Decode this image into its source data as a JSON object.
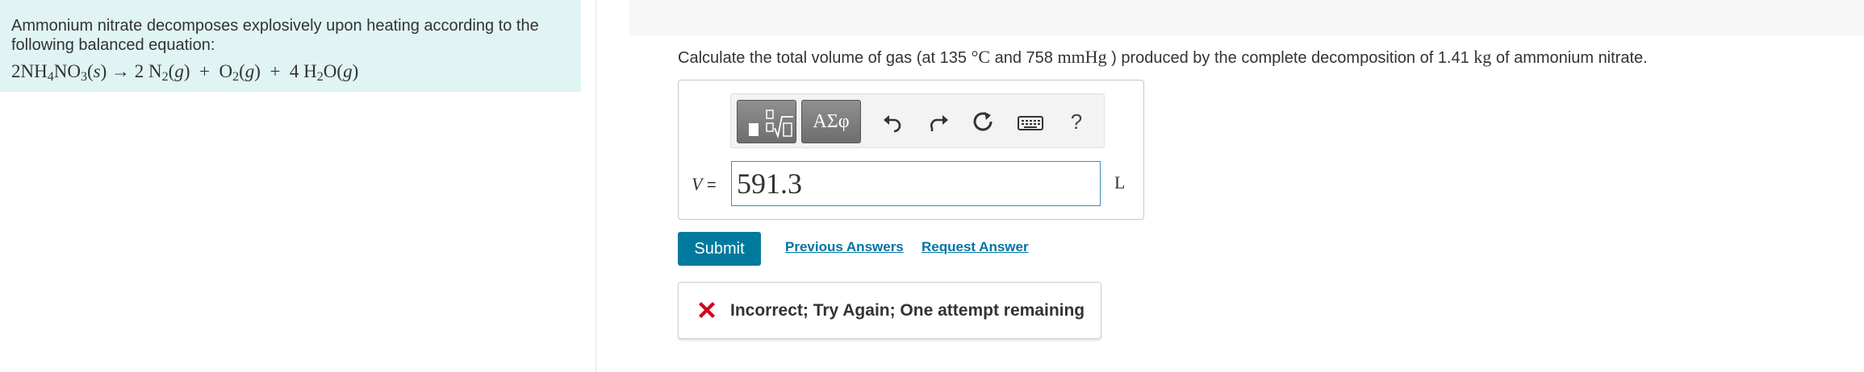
{
  "intro": {
    "text": "Ammonium nitrate decomposes explosively upon heating according to the following balanced equation:",
    "equation": {
      "r_coef_prefix": "2NH",
      "r_sub1": "4",
      "r_mid": "NO",
      "r_sub2": "3",
      "r_state": "s",
      "arrow": "→",
      "p1_prefix": "2 N",
      "p1_sub": "2",
      "p1_state": "g",
      "plus1": "+",
      "p2_prefix": "O",
      "p2_sub": "2",
      "p2_state": "g",
      "plus2": "+",
      "p3_prefix": "4 H",
      "p3_sub": "2",
      "p3_after": "O",
      "p3_state": "g"
    }
  },
  "question": {
    "part1": "Calculate the total volume of gas (at 135 ",
    "temp_unit": "°C",
    "part2": " and 758 ",
    "pressure_unit": "mmHg",
    "part3": " ) produced by the complete decomposition of 1.41 ",
    "mass_unit": "kg",
    "part4": " of ammonium nitrate."
  },
  "toolbar": {
    "symbols_label": "ΑΣφ",
    "help_label": "?"
  },
  "answer": {
    "variable": "V",
    "equals": " =",
    "value": "591.3",
    "unit": "L"
  },
  "actions": {
    "submit_label": "Submit",
    "previous_answers_label": "Previous Answers",
    "request_answer_label": "Request Answer"
  },
  "feedback": {
    "message": "Incorrect; Try Again; One attempt remaining",
    "color": "#d0021b"
  },
  "colors": {
    "intro_bg": "#e0f4f4",
    "accent": "#007a9c",
    "link": "#0074a3",
    "input_border": "#3b8ebd"
  }
}
